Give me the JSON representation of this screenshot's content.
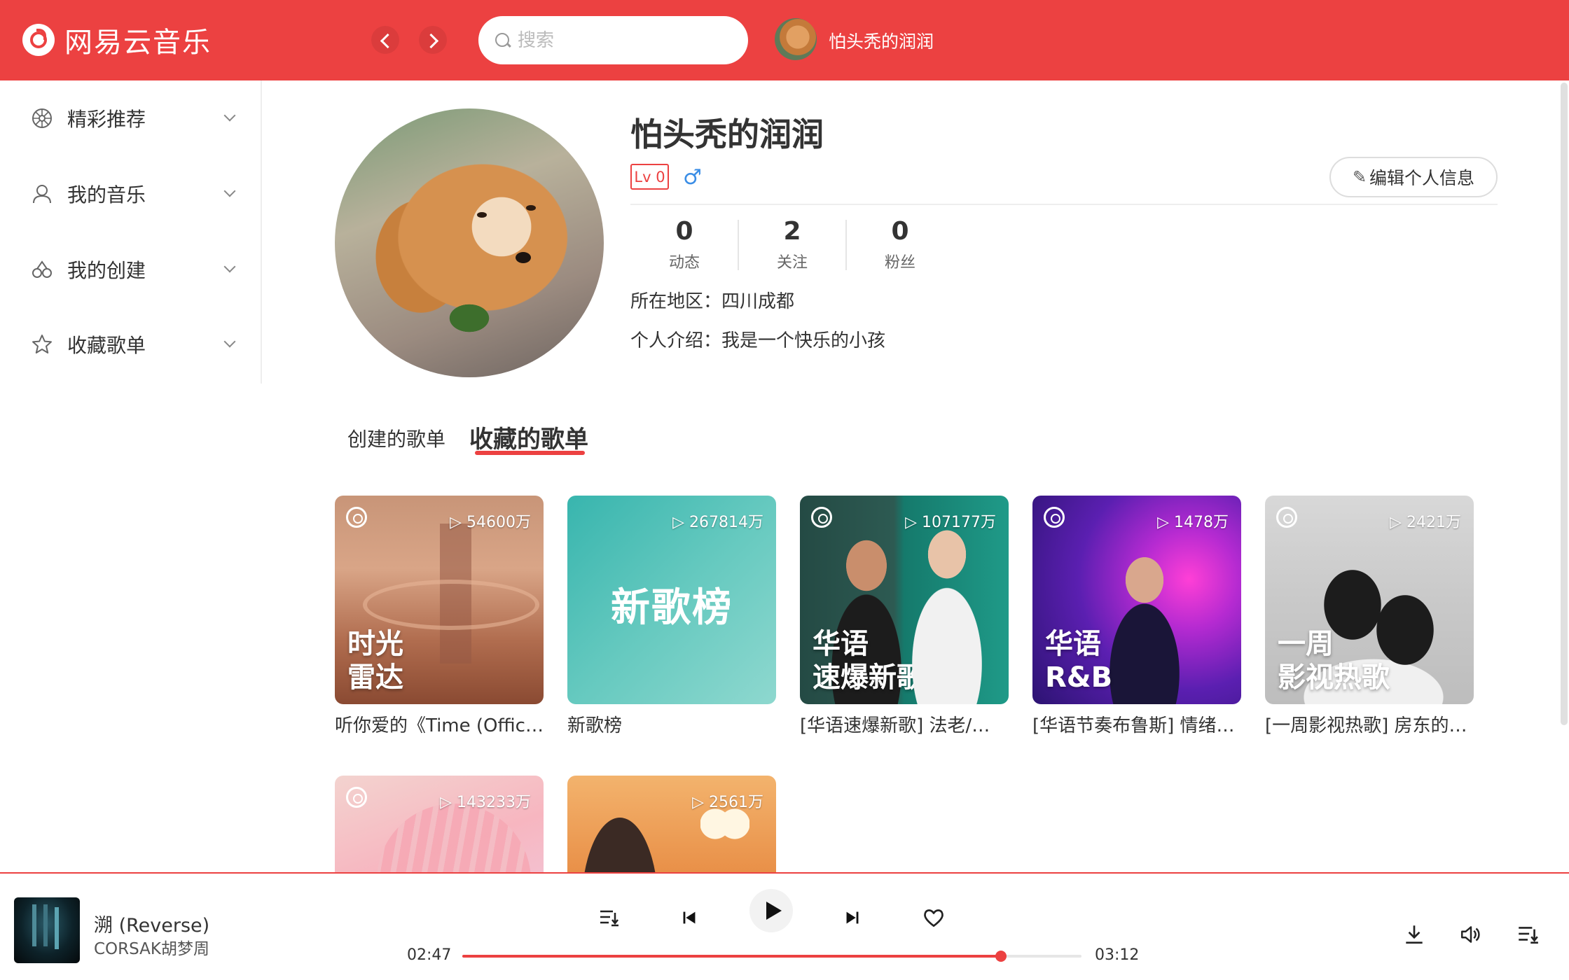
{
  "app": {
    "name": "网易云音乐",
    "accent": "#ec4141"
  },
  "header": {
    "search_placeholder": "搜索",
    "username": "怕头秃的润润"
  },
  "sidebar": {
    "items": [
      {
        "label": "精彩推荐",
        "icon": "disc-icon"
      },
      {
        "label": "我的音乐",
        "icon": "user-icon"
      },
      {
        "label": "我的创建",
        "icon": "glasses-icon"
      },
      {
        "label": "收藏歌单",
        "icon": "star-icon"
      }
    ]
  },
  "profile": {
    "name": "怕头秃的润润",
    "level": "Lv 0",
    "gender_symbol": "♂",
    "edit_label": "编辑个人信息",
    "stats": [
      {
        "num": "0",
        "label": "动态"
      },
      {
        "num": "2",
        "label": "关注"
      },
      {
        "num": "0",
        "label": "粉丝"
      }
    ],
    "region": "所在地区：四川成都",
    "bio": "个人介绍：我是一个快乐的小孩"
  },
  "tabs": [
    {
      "label": "创建的歌单",
      "active": false
    },
    {
      "label": "收藏的歌单",
      "active": true
    }
  ],
  "playlists": [
    {
      "plays": "54600万",
      "cover_text": [
        "时光",
        "雷达"
      ],
      "caption": "听你爱的《Time (Official Audio)》"
    },
    {
      "plays": "267814万",
      "cover_text": [
        "新歌榜"
      ],
      "caption": "新歌榜"
    },
    {
      "plays": "107177万",
      "cover_text": [
        "华语",
        "速爆新歌"
      ],
      "caption": "[华语速爆新歌] 法老/…"
    },
    {
      "plays": "1478万",
      "cover_text": [
        "华语",
        "R&B"
      ],
      "caption": "[华语节奏布鲁斯] 情绪…"
    },
    {
      "plays": "2421万",
      "cover_text": [
        "一周",
        "影视热歌"
      ],
      "caption": "[一周影视热歌] 房东的…"
    },
    {
      "plays": "143233万",
      "cover_text": [],
      "caption": ""
    },
    {
      "plays": "2561万",
      "cover_text": [],
      "caption": ""
    }
  ],
  "player": {
    "title": "溯 (Reverse)",
    "artist": "CORSAK胡梦周",
    "current_time": "02:47",
    "total_time": "03:12",
    "progress_fraction": 0.8698
  }
}
